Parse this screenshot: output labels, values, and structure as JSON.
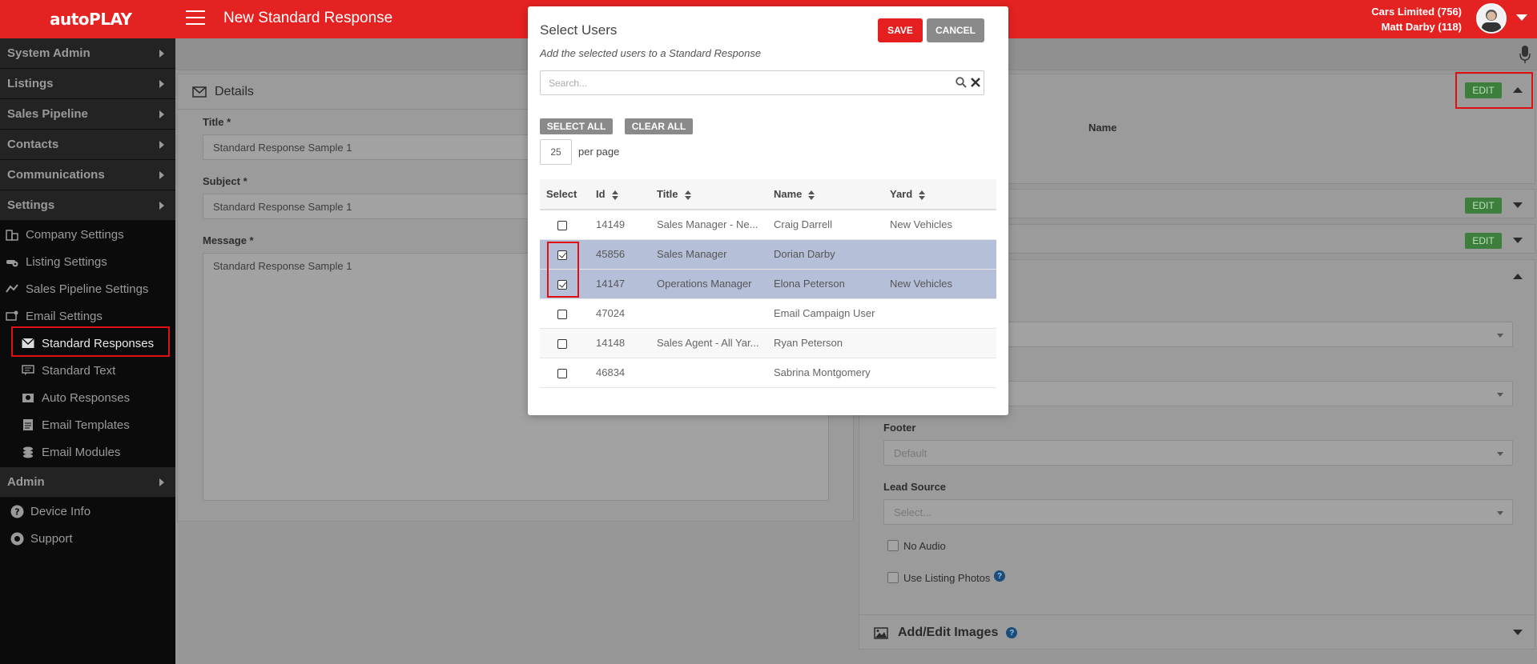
{
  "topbar": {
    "logo": "autoPLAY",
    "title": "New Standard Response",
    "dealer": "Cars Limited (756)",
    "user": "Matt Darby (118)"
  },
  "sidebar": {
    "sections": [
      {
        "label": "System Admin"
      },
      {
        "label": "Listings"
      },
      {
        "label": "Sales Pipeline"
      },
      {
        "label": "Contacts"
      },
      {
        "label": "Communications"
      },
      {
        "label": "Settings"
      }
    ],
    "settings_items": [
      {
        "label": "Company Settings",
        "icon": "building-icon"
      },
      {
        "label": "Listing Settings",
        "icon": "car-gear-icon"
      },
      {
        "label": "Sales Pipeline Settings",
        "icon": "pipeline-icon"
      },
      {
        "label": "Email Settings",
        "icon": "email-settings-icon"
      }
    ],
    "email_items": [
      {
        "label": "Standard Responses",
        "icon": "envelope-icon",
        "active": true
      },
      {
        "label": "Standard Text",
        "icon": "comment-icon"
      },
      {
        "label": "Auto Responses",
        "icon": "auto-response-icon"
      },
      {
        "label": "Email Templates",
        "icon": "template-icon"
      },
      {
        "label": "Email Modules",
        "icon": "modules-icon"
      }
    ],
    "admin": {
      "label": "Admin"
    },
    "bottom_items": [
      {
        "label": "Device Info",
        "icon": "question-circle-icon"
      },
      {
        "label": "Support",
        "icon": "lifebuoy-icon"
      }
    ]
  },
  "details": {
    "heading": "Details",
    "title_label": "Title *",
    "title_value": "Standard Response Sample 1",
    "subject_label": "Subject *",
    "subject_value": "Standard Response Sample 1",
    "message_label": "Message *",
    "message_value": "Standard Response Sample 1"
  },
  "right_panel": {
    "edit_label": "EDIT",
    "name_header": "Name",
    "footer_label": "Footer",
    "footer_value": "Default",
    "lead_source_label": "Lead Source",
    "lead_source_placeholder": "Select...",
    "no_audio_label": "No Audio",
    "use_listing_photos_label": "Use Listing Photos",
    "images_heading": "Add/Edit Images",
    "help": "?"
  },
  "modal": {
    "title": "Select Users",
    "subtitle": "Add the selected users to a Standard Response",
    "save_label": "SAVE",
    "cancel_label": "CANCEL",
    "search_placeholder": "Search...",
    "select_all_label": "SELECT ALL",
    "clear_all_label": "CLEAR ALL",
    "per_page_value": "25",
    "per_page_label": "per page",
    "columns": [
      "Select",
      "Id",
      "Title",
      "Name",
      "Yard"
    ],
    "rows": [
      {
        "id": "14149",
        "title": "Sales Manager - Ne...",
        "name": "Craig Darrell",
        "yard": "New Vehicles",
        "selected": false
      },
      {
        "id": "45856",
        "title": "Sales Manager",
        "name": "Dorian Darby",
        "yard": "",
        "selected": true
      },
      {
        "id": "14147",
        "title": "Operations Manager",
        "name": "Elona Peterson",
        "yard": "New Vehicles",
        "selected": true
      },
      {
        "id": "47024",
        "title": "",
        "name": "Email Campaign User",
        "yard": "",
        "selected": false
      },
      {
        "id": "14148",
        "title": "Sales Agent - All Yar...",
        "name": "Ryan Peterson",
        "yard": "",
        "selected": false
      },
      {
        "id": "46834",
        "title": "",
        "name": "Sabrina Montgomery",
        "yard": "",
        "selected": false
      }
    ]
  },
  "colors": {
    "brand_red": "#e52222",
    "sidebar_bg": "#0b0b0b",
    "edit_green": "#3d7e3d",
    "highlight_red": "#e01010"
  }
}
